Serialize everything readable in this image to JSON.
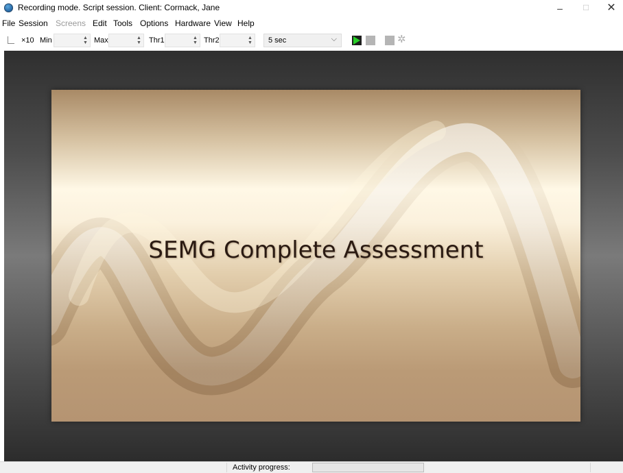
{
  "window": {
    "title": "Recording mode. Script session. Client: Cormack, Jane",
    "minimize_glyph": "–",
    "maximize_glyph": "☐",
    "close_glyph": "✕"
  },
  "menu": {
    "items": [
      {
        "label": "File"
      },
      {
        "label": "Session"
      },
      {
        "label": "Screens",
        "disabled": true
      },
      {
        "label": "Edit"
      },
      {
        "label": "Tools"
      },
      {
        "label": "Options"
      },
      {
        "label": "Hardware"
      },
      {
        "label": "View"
      },
      {
        "label": "Help"
      }
    ]
  },
  "toolbar": {
    "scale_label": "×10",
    "min_label": "Min",
    "min_value": "",
    "max_label": "Max",
    "max_value": "",
    "thr1_label": "Thr1",
    "thr1_value": "",
    "thr2_label": "Thr2",
    "thr2_value": "",
    "timebase_value": "5 sec",
    "play_color": "#28d028",
    "icons": [
      "axis-icon",
      "play-icon",
      "stop-icon",
      "record-icon",
      "gear-icon"
    ]
  },
  "slide": {
    "title": "SEMG Complete Assessment"
  },
  "status": {
    "activity_label": "Activity progress:",
    "activity_progress": 0
  }
}
